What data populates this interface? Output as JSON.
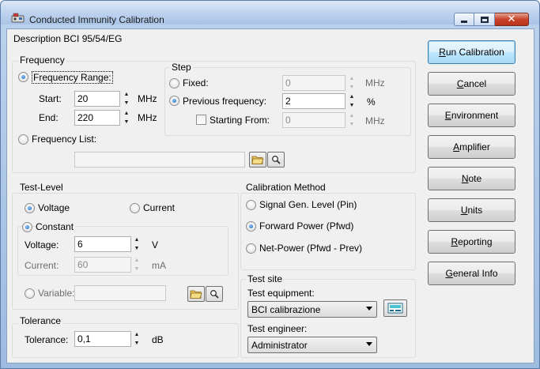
{
  "window": {
    "title": "Conducted Immunity Calibration"
  },
  "description": "Description BCI 95/54/EG",
  "frequency": {
    "group_title": "Frequency",
    "range_radio_label": "Frequency Range:",
    "start_label": "Start:",
    "start_value": "20",
    "start_unit": "MHz",
    "end_label": "End:",
    "end_value": "220",
    "end_unit": "MHz",
    "list_radio_label": "Frequency List:",
    "list_path_value": "",
    "step": {
      "group_title": "Step",
      "fixed_label": "Fixed:",
      "fixed_value": "0",
      "fixed_unit": "MHz",
      "previous_label": "Previous frequency:",
      "previous_value": "2",
      "previous_unit": "%",
      "starting_from_label": "Starting From:",
      "starting_from_value": "0",
      "starting_from_unit": "MHz"
    }
  },
  "test_level": {
    "group_title": "Test-Level",
    "voltage_label": "Voltage",
    "current_label": "Current",
    "constant_label": "Constant",
    "voltage_field_label": "Voltage:",
    "voltage_value": "6",
    "voltage_unit": "V",
    "current_field_label": "Current:",
    "current_value": "60",
    "current_unit": "mA",
    "variable_label": "Variable:",
    "variable_value": ""
  },
  "tolerance": {
    "group_title": "Tolerance",
    "field_label": "Tolerance:",
    "value": "0,1",
    "unit": "dB"
  },
  "calibration_method": {
    "group_title": "Calibration Method",
    "options": [
      "Signal Gen. Level (Pin)",
      "Forward Power (Pfwd)",
      "Net-Power (Pfwd - Prev)"
    ],
    "selected": "Forward Power (Pfwd)"
  },
  "test_site": {
    "group_title": "Test site",
    "equipment_label": "Test equipment:",
    "equipment_value": "BCI calibrazione",
    "engineer_label": "Test engineer:",
    "engineer_value": "Administrator"
  },
  "buttons": {
    "run_calibration": {
      "underline": "R",
      "rest": "un Calibration"
    },
    "cancel": {
      "underline": "C",
      "rest": "ancel"
    },
    "environment": {
      "underline": "E",
      "rest": "nvironment"
    },
    "amplifier": {
      "underline": "A",
      "rest": "mplifier"
    },
    "note": {
      "underline": "N",
      "rest": "ote"
    },
    "units": {
      "underline": "U",
      "rest": "nits"
    },
    "reporting": {
      "underline": "R",
      "rest": "eporting"
    },
    "general_info": {
      "underline": "G",
      "rest": "eneral Info"
    }
  },
  "icons": [
    "window-app-icon",
    "folder-open-icon",
    "magnifier-icon",
    "equipment-edit-icon"
  ],
  "colors": {
    "accent": "#1b5fae",
    "titlebar": "#bed3ef",
    "close_button": "#c9432a"
  }
}
